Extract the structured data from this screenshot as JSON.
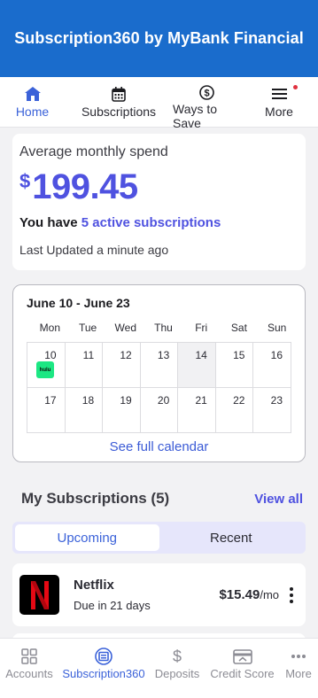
{
  "header": {
    "title": "Subscription360 by MyBank Financial"
  },
  "topnav": {
    "tabs": [
      {
        "label": "Home",
        "icon": "home-icon",
        "active": true
      },
      {
        "label": "Subscriptions",
        "icon": "calendar-icon",
        "active": false
      },
      {
        "label": "Ways to Save",
        "icon": "dollar-circle-icon",
        "active": false
      },
      {
        "label": "More",
        "icon": "menu-icon",
        "active": false
      }
    ]
  },
  "spend": {
    "label": "Average monthly spend",
    "currency": "$",
    "amount": "199.45",
    "subs_prefix": "You have",
    "subs_link": "5 active subscriptions",
    "updated": "Last Updated a minute ago"
  },
  "calendar": {
    "range": "June 10 - June 23",
    "dows": [
      "Mon",
      "Tue",
      "Wed",
      "Thu",
      "Fri",
      "Sat",
      "Sun"
    ],
    "days": [
      "10",
      "11",
      "12",
      "13",
      "14",
      "15",
      "16",
      "17",
      "18",
      "19",
      "20",
      "21",
      "22",
      "23"
    ],
    "event_label": "hulu",
    "full_link": "See full calendar"
  },
  "subscriptions": {
    "title": "My Subscriptions (5)",
    "view_all": "View all",
    "segments": [
      "Upcoming",
      "Recent"
    ],
    "items": [
      {
        "name": "Netflix",
        "due": "Due in 21 days",
        "price": "$15.49",
        "per": "/mo"
      }
    ]
  },
  "bottomnav": {
    "items": [
      {
        "label": "Accounts",
        "icon": "grid-icon"
      },
      {
        "label": "Subscription360",
        "icon": "subscription-icon"
      },
      {
        "label": "Deposits",
        "icon": "dollar-icon"
      },
      {
        "label": "Credit Score",
        "icon": "card-icon"
      },
      {
        "label": "More",
        "icon": "dots-icon"
      }
    ]
  },
  "colors": {
    "brand": "#1a6ccc",
    "accent": "#4f52e0",
    "hulu": "#1ce783",
    "netflix_red": "#e50914"
  }
}
